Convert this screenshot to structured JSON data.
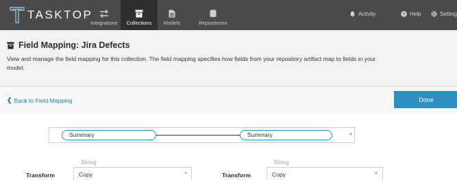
{
  "brand": {
    "name": "TASKTOP"
  },
  "nav": {
    "items": [
      {
        "label": "Integrations",
        "icon": "arrows-icon"
      },
      {
        "label": "Collections",
        "icon": "archive-icon",
        "active": true
      },
      {
        "label": "Models",
        "icon": "document-icon"
      },
      {
        "label": "Repositories",
        "icon": "database-icon"
      }
    ],
    "right": {
      "activity": "Activity",
      "help": "Help",
      "settings": "Setting"
    }
  },
  "header": {
    "title": "Field Mapping: Jira Defects",
    "description": "View and manage the field mapping for this collection. The field mapping specifies how fields from your repository artifact map to fields in your model."
  },
  "actions": {
    "back": "Back to Field Mapping",
    "done": "Done"
  },
  "mapping": {
    "left_field": "Summary",
    "right_field": "Summary",
    "left_type": "String",
    "right_type": "String",
    "transform_label": "Transform",
    "left_transform": "Copy",
    "right_transform": "Copy"
  },
  "colors": {
    "nav_bg": "#4a4a4a",
    "accent": "#2b8fbf",
    "link": "#1a7fa5",
    "header_bg": "#f2f2f2"
  }
}
